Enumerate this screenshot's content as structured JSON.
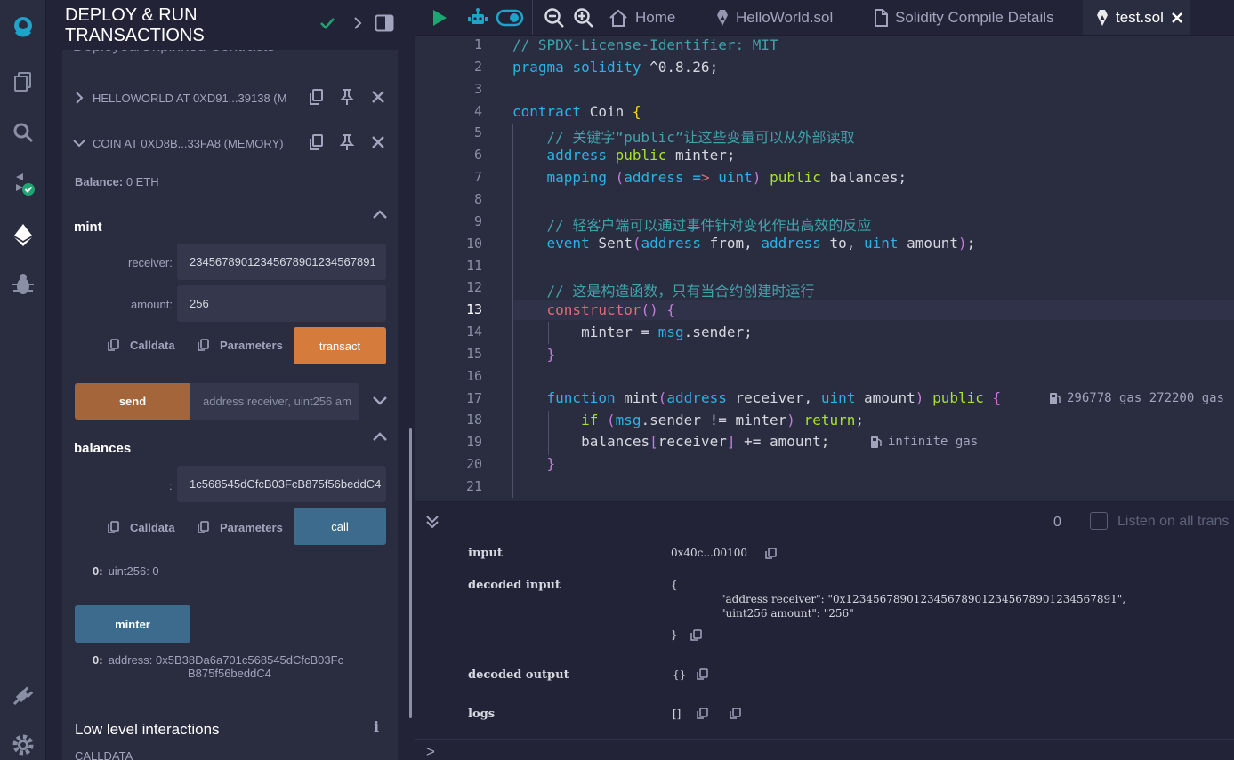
{
  "panel": {
    "title": "DEPLOY & RUN TRANSACTIONS",
    "under_title": "Deployed/Unpinned Contracts",
    "contracts": [
      {
        "name": "HELLOWORLD AT 0XD91...39138 (M"
      },
      {
        "name": "COIN AT 0XD8B...33FA8 (MEMORY)"
      }
    ],
    "balance_label": "Balance:",
    "balance_value": "0 ETH",
    "mint": {
      "title": "mint",
      "receiver_label": "receiver:",
      "receiver_value": "23456789012345678901234567891",
      "amount_label": "amount:",
      "amount_value": "256",
      "calldata": "Calldata",
      "parameters": "Parameters",
      "transact": "transact"
    },
    "send": {
      "label": "send",
      "placeholder": "address receiver, uint256 am"
    },
    "balances": {
      "title": "balances",
      "colon": ":",
      "value": "1c568545dCfcB03FcB875f56beddC4",
      "calldata": "Calldata",
      "parameters": "Parameters",
      "call": "call",
      "result_index": "0:",
      "result_value": "uint256: 0"
    },
    "minter": {
      "label": "minter",
      "result_index": "0:",
      "result_line1": "address: 0x5B38Da6a701c568545dCfcB03Fc",
      "result_line2": "B875f56beddC4"
    },
    "low_level": "Low level interactions",
    "calldata_caption": "CALLDATA"
  },
  "tabs": {
    "home": "Home",
    "helloworld": "HelloWorld.sol",
    "compile_details": "Solidity Compile Details",
    "test": "test.sol"
  },
  "editor": {
    "current_line": 13,
    "line_numbers": [
      "1",
      "2",
      "3",
      "4",
      "5",
      "6",
      "7",
      "8",
      "9",
      "10",
      "11",
      "12",
      "13",
      "14",
      "15",
      "16",
      "17",
      "18",
      "19",
      "20",
      "21"
    ],
    "comment_1": "// SPDX-License-Identifier: MIT",
    "pragma_kw": "pragma",
    "solidity_kw": "solidity",
    "version": " ^0.8.26;",
    "contract_kw": "contract",
    "contract_name": " Coin ",
    "comment_5": "// 关键字“public”让这些变量可以从外部读取",
    "comment_9": "// 轻客户端可以通过事件针对变化作出高效的反应",
    "comment_12": "// 这是构造函数，只有当合约创建时运行",
    "gas_17": "296778 gas 272200 gas",
    "gas_19": "infinite gas"
  },
  "terminal": {
    "count": "0",
    "listen_label": "Listen on all trans",
    "rows": {
      "input_key": "input",
      "input_value": "0x40c...00100",
      "decoded_input_key": "decoded input",
      "decoded_open": "{",
      "decoded_line1": "\"address receiver\": \"0x12345678901234567890123456789012345678​91\",",
      "decoded_line2": "\"uint256 amount\": \"256\"",
      "decoded_close": "}",
      "decoded_output_key": "decoded output",
      "decoded_output_value": "{}",
      "logs_key": "logs",
      "logs_value": "[]"
    },
    "prompt": ">"
  },
  "colors": {
    "accent_orange": "#d57c3c",
    "accent_blue": "#3d6b8d",
    "success_green": "#1ea672",
    "brand_teal": "#1fa3c9"
  }
}
